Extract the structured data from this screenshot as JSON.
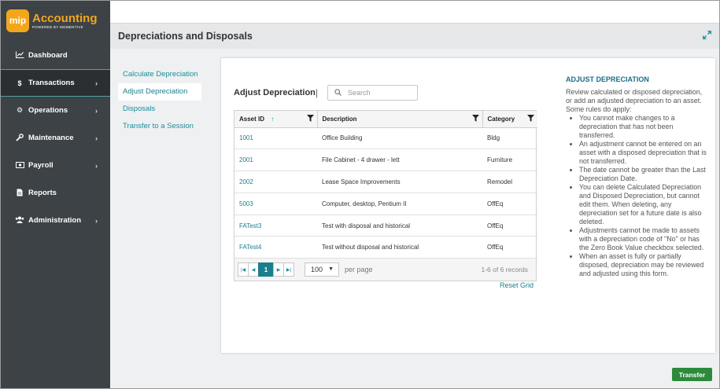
{
  "app": {
    "logo_badge": "mip",
    "title": "Accounting",
    "subtitle": "POWERED BY MOMENTIVE",
    "accent_color": "#f2a71b",
    "sidebar_bg": "#3d4246",
    "link_color": "#1a7f8c"
  },
  "nav": [
    {
      "label": "Dashboard",
      "icon": "chart-line-icon",
      "has_submenu": false,
      "active": false
    },
    {
      "label": "Transactions",
      "icon": "dollar-icon",
      "has_submenu": true,
      "active": true
    },
    {
      "label": "Operations",
      "icon": "gears-icon",
      "has_submenu": true,
      "active": false
    },
    {
      "label": "Maintenance",
      "icon": "wrench-icon",
      "has_submenu": true,
      "active": false
    },
    {
      "label": "Payroll",
      "icon": "money-icon",
      "has_submenu": true,
      "active": false
    },
    {
      "label": "Reports",
      "icon": "report-icon",
      "has_submenu": false,
      "active": false
    },
    {
      "label": "Administration",
      "icon": "users-icon",
      "has_submenu": true,
      "active": false
    }
  ],
  "header": {
    "title": "Depreciations and Disposals"
  },
  "subnav": [
    {
      "label": "Calculate Depreciation",
      "active": false
    },
    {
      "label": "Adjust Depreciation",
      "active": true
    },
    {
      "label": "Disposals",
      "active": false
    },
    {
      "label": "Transfer to a Session",
      "active": false
    }
  ],
  "grid": {
    "title": "Adjust Depreciation",
    "separator": "|",
    "search_placeholder": "Search",
    "columns": [
      "Asset ID",
      "Description",
      "Category"
    ],
    "rows": [
      [
        "1001",
        "Office Building",
        "Bldg"
      ],
      [
        "2001",
        "File Cabinet - 4 drawer - lett",
        "Furniture"
      ],
      [
        "2002",
        "Lease Space Improvements",
        "Remodel"
      ],
      [
        "5003",
        "Computer, desktop, Pentium II",
        "OffEq"
      ],
      [
        "FATest3",
        "Test with disposal and historical",
        "OffEq"
      ],
      [
        "FATest4",
        "Test without disposal and historical",
        "OffEq"
      ]
    ],
    "pager": {
      "current_page": "1",
      "page_size": "100",
      "per_page_label": "per page",
      "records_label": "1-6 of 6 records"
    },
    "reset_label": "Reset Grid"
  },
  "help": {
    "title": "ADJUST DEPRECIATION",
    "intro": "Review calculated or disposed depreciation, or add an adjusted depreciation to an asset.",
    "rules_intro": "Some rules do apply:",
    "rules": [
      "You cannot make changes to a depreciation that has not been transferred.",
      "An adjustment cannot be entered on an asset with a disposed depreciation that is not transferred.",
      "The date cannot be greater than the Last Depreciation Date.",
      "You can delete Calculated Depreciation and Disposed Depreciation, but cannot edit them. When deleting, any depreciation set for a future date is also deleted.",
      "Adjustments cannot be made to assets with a depreciation code of \"No\" or has the Zero Book Value checkbox selected.",
      "When an asset is fully or partially disposed, depreciation may be reviewed and adjusted using this form."
    ]
  },
  "footer": {
    "transfer_label": "Transfer",
    "transfer_color": "#2c8a3c"
  }
}
